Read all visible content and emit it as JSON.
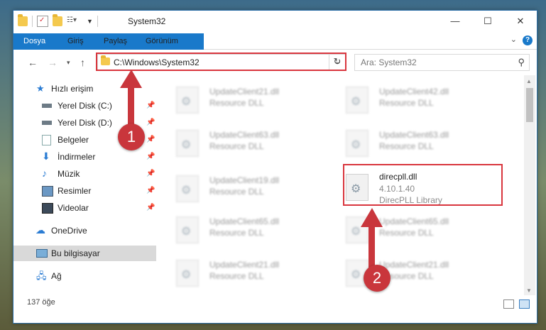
{
  "window": {
    "title": "System32",
    "controls": [
      "minimize-icon",
      "maximize-icon",
      "close-icon"
    ]
  },
  "ribbon": {
    "tabs": [
      "Dosya",
      "Giriş",
      "Paylaş",
      "Görünüm"
    ],
    "help_label": "?"
  },
  "navigation": {
    "address": "C:\\Windows\\System32",
    "search_placeholder": "Ara: System32"
  },
  "sidebar": {
    "items": [
      {
        "label": "Hızlı erişim",
        "icon": "star-icon"
      },
      {
        "label": "Yerel Disk (C:)",
        "icon": "drive-icon",
        "pinned": true
      },
      {
        "label": "Yerel Disk (D:)",
        "icon": "drive-icon",
        "pinned": true
      },
      {
        "label": "Belgeler",
        "icon": "documents-icon",
        "pinned": true
      },
      {
        "label": "İndirmeler",
        "icon": "download-icon",
        "pinned": true
      },
      {
        "label": "Müzik",
        "icon": "music-icon",
        "pinned": true
      },
      {
        "label": "Resimler",
        "icon": "pictures-icon",
        "pinned": true
      },
      {
        "label": "Videolar",
        "icon": "videos-icon",
        "pinned": true
      },
      {
        "label": "OneDrive",
        "icon": "cloud-icon"
      },
      {
        "label": "Bu bilgisayar",
        "icon": "computer-icon",
        "selected": true
      },
      {
        "label": "Ağ",
        "icon": "network-icon"
      }
    ]
  },
  "files": {
    "left_column": [
      {
        "name": "UpdateClient21.dll",
        "desc": "Resource DLL"
      },
      {
        "name": "UpdateClient63.dll",
        "desc": "Resource DLL"
      },
      {
        "name": "UpdateClient19.dll",
        "desc": "Resource DLL"
      },
      {
        "name": "UpdateClient65.dll",
        "desc": "Resource DLL"
      },
      {
        "name": "UpdateClient21.dll",
        "desc": "Resource DLL"
      }
    ],
    "right_column": [
      {
        "name": "UpdateClient42.dll",
        "desc": "Resource DLL"
      },
      {
        "name": "UpdateClient63.dll",
        "desc": "Resource DLL"
      },
      {
        "name": "direcpll.dll",
        "version": "4.10.1.40",
        "desc": "DirecPLL Library",
        "highlighted": true
      },
      {
        "name": "UpdateClient65.dll",
        "desc": "Resource DLL"
      },
      {
        "name": "UpdateClient21.dll",
        "desc": "Resource DLL"
      }
    ]
  },
  "status": {
    "item_count": "137 öğe"
  },
  "callouts": [
    "1",
    "2"
  ],
  "colors": {
    "accent": "#1979ca",
    "highlight": "#d9363e",
    "selection": "#d9d9d9"
  }
}
